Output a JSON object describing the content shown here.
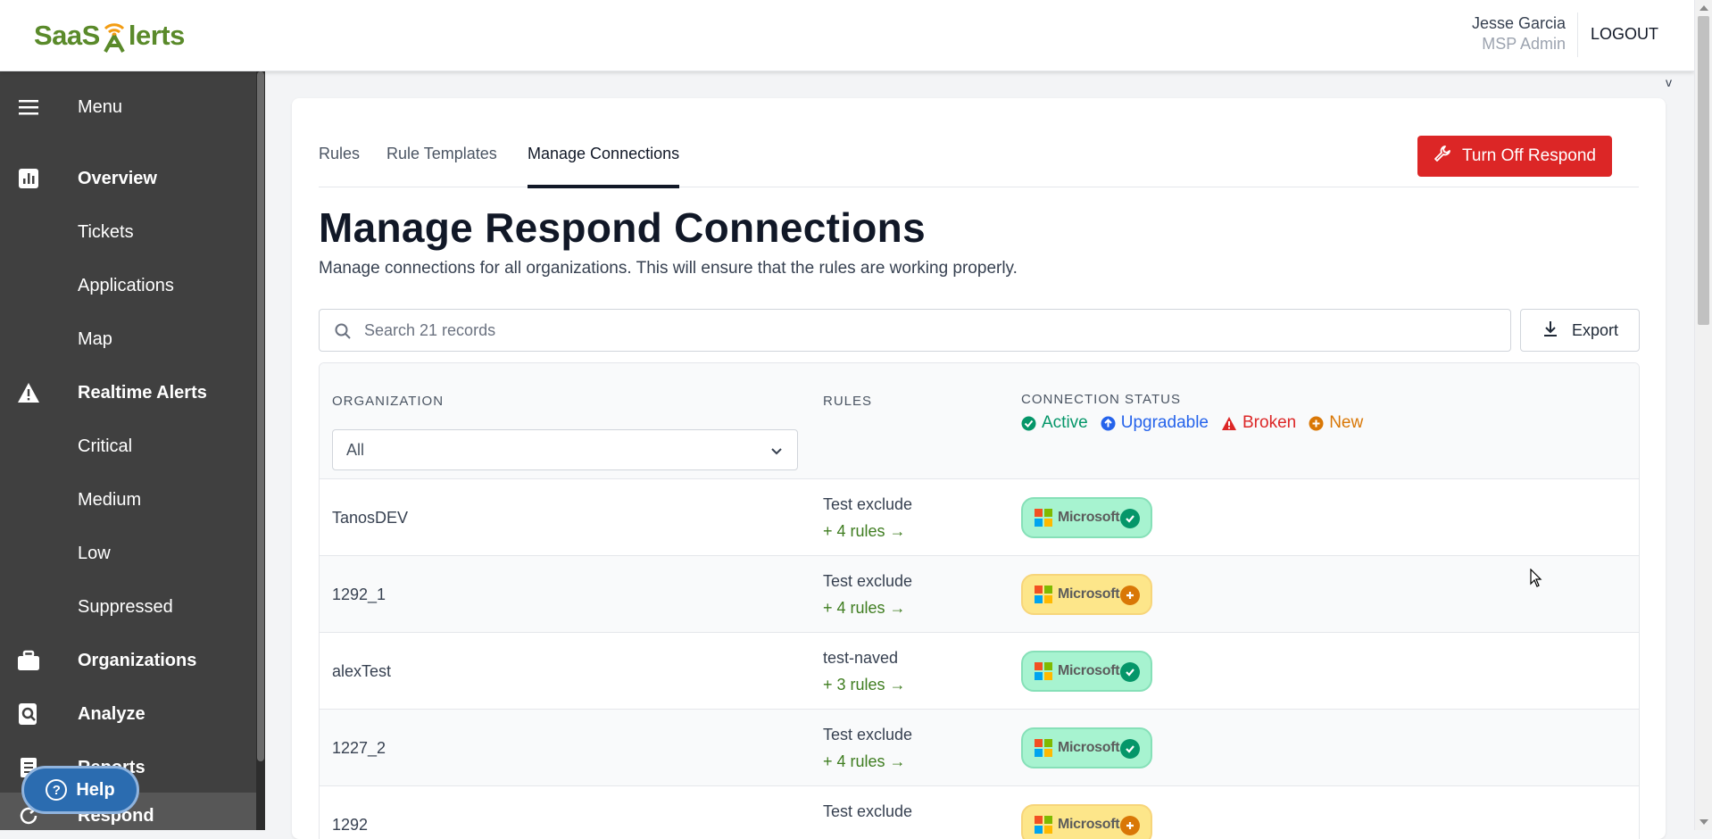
{
  "header": {
    "logo_text_left": "SaaS",
    "logo_text_right": "lerts",
    "user_name": "Jesse Garcia",
    "user_role": "MSP Admin",
    "logout_label": "LOGOUT",
    "corner_label": "v"
  },
  "sidebar": {
    "items": [
      {
        "label": "Menu",
        "icon": "hamburger-icon"
      },
      {
        "label": "Overview",
        "icon": "bar-chart-icon"
      },
      {
        "label": "Tickets"
      },
      {
        "label": "Applications"
      },
      {
        "label": "Map"
      },
      {
        "label": "Realtime Alerts",
        "icon": "warning-icon"
      },
      {
        "label": "Critical"
      },
      {
        "label": "Medium"
      },
      {
        "label": "Low"
      },
      {
        "label": "Suppressed"
      },
      {
        "label": "Organizations",
        "icon": "briefcase-icon"
      },
      {
        "label": "Analyze",
        "icon": "magnify-icon"
      },
      {
        "label": "Reports",
        "icon": "reports-icon"
      },
      {
        "label": "Respond",
        "icon": "refresh-icon"
      }
    ],
    "help_label": "Help"
  },
  "tabs": [
    {
      "label": "Rules"
    },
    {
      "label": "Rule Templates"
    },
    {
      "label": "Manage Connections"
    }
  ],
  "turn_off_label": "Turn Off Respond",
  "page": {
    "title": "Manage Respond Connections",
    "description": "Manage connections for all organizations. This will ensure that the rules are working properly."
  },
  "search": {
    "placeholder": "Search 21 records",
    "value": ""
  },
  "export_label": "Export",
  "table": {
    "headers": {
      "organization": "ORGANIZATION",
      "rules": "RULES",
      "connection_status": "CONNECTION STATUS"
    },
    "org_filter_value": "All",
    "legend": [
      {
        "label": "Active",
        "color": "#059669"
      },
      {
        "label": "Upgradable",
        "color": "#2563eb"
      },
      {
        "label": "Broken",
        "color": "#dc2626"
      },
      {
        "label": "New",
        "color": "#d97706"
      }
    ],
    "rows": [
      {
        "org": "TanosDEV",
        "rule": "Test exclude",
        "more": "+ 4 rules →",
        "connection": "Microsoft",
        "status": "active"
      },
      {
        "org": "1292_1",
        "rule": "Test exclude",
        "more": "+ 4 rules →",
        "connection": "Microsoft",
        "status": "new"
      },
      {
        "org": "alexTest",
        "rule": "test-naved",
        "more": "+ 3 rules →",
        "connection": "Microsoft",
        "status": "active"
      },
      {
        "org": "1227_2",
        "rule": "Test exclude",
        "more": "+ 4 rules →",
        "connection": "Microsoft",
        "status": "active"
      },
      {
        "org": "1292",
        "rule": "Test exclude",
        "more": "",
        "connection": "Microsoft",
        "status": "new"
      }
    ]
  },
  "colors": {
    "brand_green": "#5a8a2a",
    "brand_orange": "#f39c12",
    "sidebar_bg": "#404040",
    "danger": "#dc2626",
    "link_green": "#3f7d20"
  }
}
